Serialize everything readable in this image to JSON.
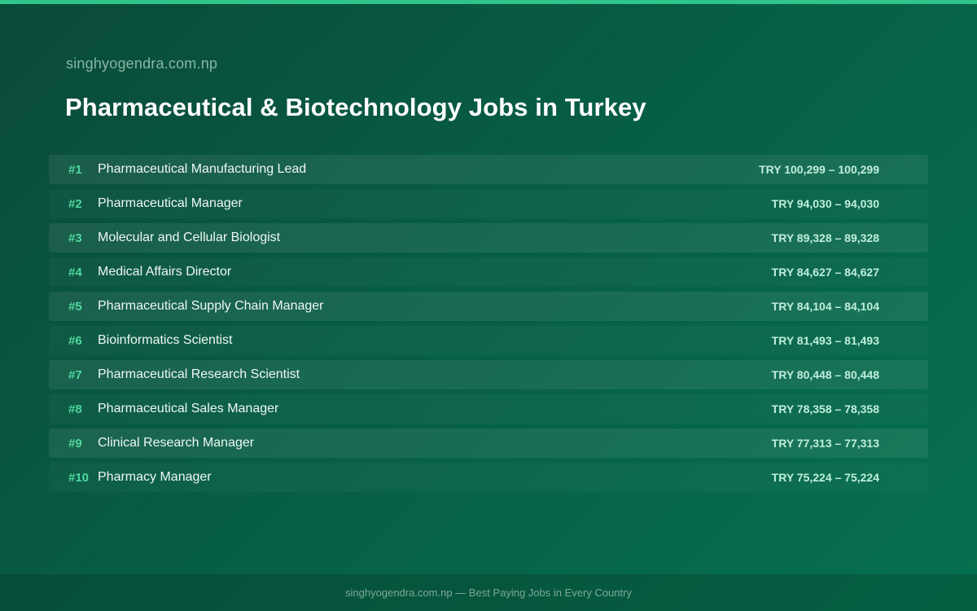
{
  "site": {
    "name": "singhyogendra.com.np"
  },
  "page": {
    "title": "Pharmaceutical & Biotechnology Jobs in Turkey"
  },
  "jobs": [
    {
      "rank": "#1",
      "title": "Pharmaceutical Manufacturing Lead",
      "salary": "TRY 100,299 – 100,299"
    },
    {
      "rank": "#2",
      "title": "Pharmaceutical Manager",
      "salary": "TRY 94,030 – 94,030"
    },
    {
      "rank": "#3",
      "title": "Molecular and Cellular Biologist",
      "salary": "TRY 89,328 – 89,328"
    },
    {
      "rank": "#4",
      "title": "Medical Affairs Director",
      "salary": "TRY 84,627 – 84,627"
    },
    {
      "rank": "#5",
      "title": "Pharmaceutical Supply Chain Manager",
      "salary": "TRY 84,104 – 84,104"
    },
    {
      "rank": "#6",
      "title": "Bioinformatics Scientist",
      "salary": "TRY 81,493 – 81,493"
    },
    {
      "rank": "#7",
      "title": "Pharmaceutical Research Scientist",
      "salary": "TRY 80,448 – 80,448"
    },
    {
      "rank": "#8",
      "title": "Pharmaceutical Sales Manager",
      "salary": "TRY 78,358 – 78,358"
    },
    {
      "rank": "#9",
      "title": "Clinical Research Manager",
      "salary": "TRY 77,313 – 77,313"
    },
    {
      "rank": "#10",
      "title": "Pharmacy Manager",
      "salary": "TRY 75,224 – 75,224"
    }
  ],
  "footer": {
    "text": "singhyogendra.com.np — Best Paying Jobs in Every Country"
  },
  "colors": {
    "accent": "#2fc489",
    "rank": "#4fd79d",
    "background_start": "#0a4a39",
    "background_end": "#06704f"
  }
}
